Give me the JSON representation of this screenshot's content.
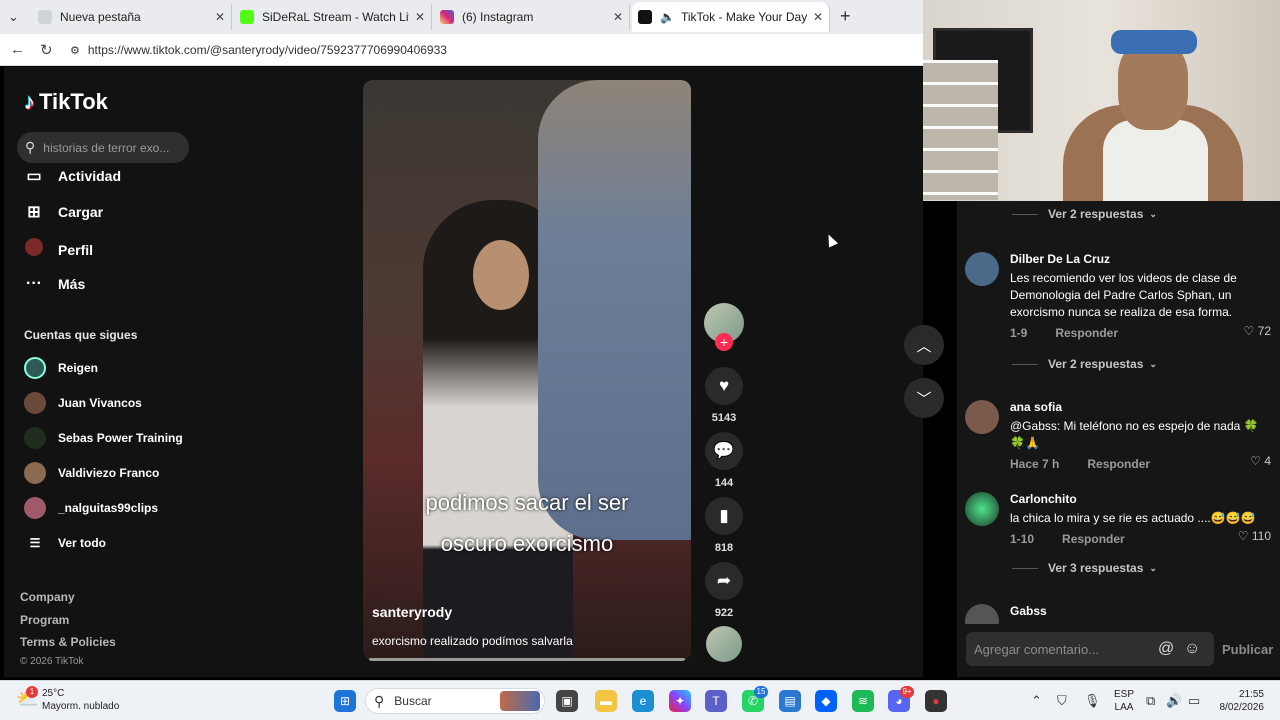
{
  "browser": {
    "tabs": [
      {
        "title": "Nueva pestaña",
        "active": false
      },
      {
        "title": "SiDeRaL Stream - Watch Live on K",
        "active": false
      },
      {
        "title": "(6) Instagram",
        "active": false
      },
      {
        "title": "TikTok - Make Your Day",
        "active": true
      }
    ],
    "url": "https://www.tiktok.com/@santeryrody/video/7592377706990406933"
  },
  "tiktok": {
    "logo": "TikTok",
    "search_placeholder": "historias de terror exo...",
    "nav": [
      {
        "label": "Actividad",
        "icon": "activity-icon"
      },
      {
        "label": "Cargar",
        "icon": "upload-icon"
      },
      {
        "label": "Perfil",
        "icon": "profile-icon"
      },
      {
        "label": "Más",
        "icon": "more-icon"
      }
    ],
    "following_title": "Cuentas que sigues",
    "following": [
      "Reigen",
      "Juan Vivancos",
      "Sebas Power Training",
      "Valdiviezo Franco",
      "_nalguitas99clips"
    ],
    "see_all": "Ver todo",
    "footer": [
      "Company",
      "Program",
      "Terms & Policies"
    ],
    "copyright": "© 2026 TikTok"
  },
  "video": {
    "caption_line1": "podimos sacar el ser",
    "caption_line2": "oscuro exorcismo",
    "username": "santeryrody",
    "description": "exorcismo realizado podímos salvarla",
    "likes": "5143",
    "comments": "144",
    "saves": "818",
    "shares": "922"
  },
  "comments": {
    "items": [
      {
        "replies": "Ver 2 respuestas"
      },
      {
        "name": "Dilber De La Cruz",
        "text": "Les recomiendo ver los videos de clase de Demonologia del Padre Carlos Sphan, un exorcismo nunca se realiza de esa forma.",
        "date": "1-9",
        "reply": "Responder",
        "likes": "72"
      },
      {
        "replies": "Ver 2 respuestas"
      },
      {
        "name": "ana sofia",
        "text": "@Gabss: Mi teléfono no es espejo de nada 🍀🍀🙏",
        "date": "Hace 7 h",
        "reply": "Responder",
        "likes": "4"
      },
      {
        "name": "Carlonchito",
        "text": "la chica lo mira y se rie es actuado ....😅😅😅",
        "date": "1-10",
        "reply": "Responder",
        "likes": "110"
      },
      {
        "replies": "Ver 3 respuestas"
      },
      {
        "name": "Gabss"
      }
    ],
    "input_placeholder": "Agregar comentario...",
    "publish": "Publicar"
  },
  "taskbar": {
    "weather_temp": "25°C",
    "weather_desc": "Mayorm. nublado",
    "weather_badge": "1",
    "search": "Buscar",
    "whatsapp_badge": "15",
    "discord_badge": "9+",
    "lang1": "ESP",
    "lang2": "LAA",
    "time": "21:55",
    "date": "8/02/2026"
  },
  "colors": {
    "tiktok_red": "#fe2c55",
    "page_bg": "#121212"
  }
}
